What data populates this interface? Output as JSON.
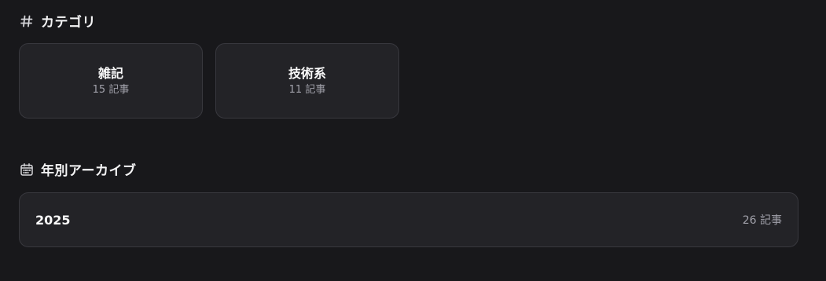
{
  "categories_section": {
    "title": "カテゴリ",
    "icon": "hash-icon",
    "items": [
      {
        "name": "雑記",
        "count": "15 記事"
      },
      {
        "name": "技術系",
        "count": "11 記事"
      }
    ]
  },
  "archive_section": {
    "title": "年別アーカイブ",
    "icon": "calendar-icon",
    "items": [
      {
        "year": "2025",
        "count": "26 記事"
      }
    ]
  },
  "colors": {
    "background": "#18181b",
    "card_background": "#232327",
    "card_border": "#38383e",
    "text_primary": "#fafafa",
    "text_secondary": "#a1a1aa"
  }
}
